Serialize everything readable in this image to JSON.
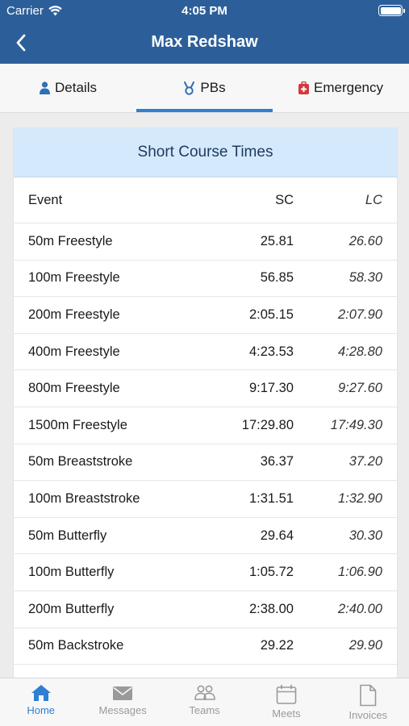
{
  "status": {
    "carrier": "Carrier",
    "time": "4:05 PM"
  },
  "nav": {
    "title": "Max Redshaw"
  },
  "tabs": [
    {
      "label": "Details",
      "icon": "person-icon"
    },
    {
      "label": "PBs",
      "icon": "medal-icon"
    },
    {
      "label": "Emergency",
      "icon": "medical-kit-icon"
    }
  ],
  "card": {
    "title": "Short Course Times",
    "columns": {
      "event": "Event",
      "sc": "SC",
      "lc": "LC"
    },
    "rows": [
      {
        "event": "50m Freestyle",
        "sc": "25.81",
        "lc": "26.60"
      },
      {
        "event": "100m Freestyle",
        "sc": "56.85",
        "lc": "58.30"
      },
      {
        "event": "200m Freestyle",
        "sc": "2:05.15",
        "lc": "2:07.90"
      },
      {
        "event": "400m Freestyle",
        "sc": "4:23.53",
        "lc": "4:28.80"
      },
      {
        "event": "800m Freestyle",
        "sc": "9:17.30",
        "lc": "9:27.60"
      },
      {
        "event": "1500m Freestyle",
        "sc": "17:29.80",
        "lc": "17:49.30"
      },
      {
        "event": "50m Breaststroke",
        "sc": "36.37",
        "lc": "37.20"
      },
      {
        "event": "100m Breaststroke",
        "sc": "1:31.51",
        "lc": "1:32.90"
      },
      {
        "event": "50m Butterfly",
        "sc": "29.64",
        "lc": "30.30"
      },
      {
        "event": "100m Butterfly",
        "sc": "1:05.72",
        "lc": "1:06.90"
      },
      {
        "event": "200m Butterfly",
        "sc": "2:38.00",
        "lc": "2:40.00"
      },
      {
        "event": "50m Backstroke",
        "sc": "29.22",
        "lc": "29.90"
      }
    ]
  },
  "tabbar": [
    {
      "label": "Home",
      "icon": "home-icon"
    },
    {
      "label": "Messages",
      "icon": "envelope-icon"
    },
    {
      "label": "Teams",
      "icon": "people-icon"
    },
    {
      "label": "Meets",
      "icon": "calendar-icon"
    },
    {
      "label": "Invoices",
      "icon": "document-icon"
    }
  ],
  "colors": {
    "header": "#2c5f9a",
    "accent": "#2f7fd3",
    "card_header": "#d4e9fb"
  }
}
